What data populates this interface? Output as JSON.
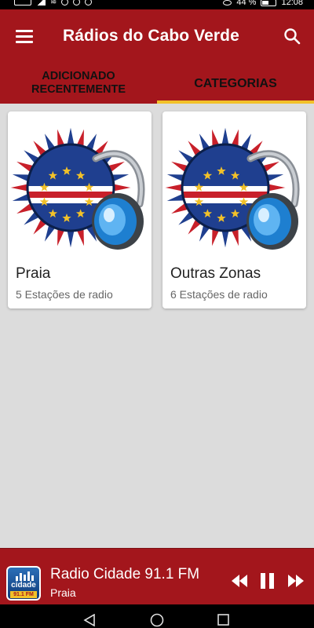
{
  "status_bar": {
    "battery": "44 %",
    "time": "12:08"
  },
  "app_bar": {
    "title": "Rádios do Cabo Verde",
    "menu_icon": "hamburger-menu-icon",
    "search_icon": "search-icon"
  },
  "tabs": [
    {
      "label": "ADICIONADO RECENTEMENTE",
      "active": false
    },
    {
      "label": "CATEGORIAS",
      "active": true
    }
  ],
  "categories": [
    {
      "name": "Praia",
      "count": "5 Estações de radio",
      "image": "cabo-verde-flag-headphones"
    },
    {
      "name": "Outras Zonas",
      "count": "6 Estações de radio",
      "image": "cabo-verde-flag-headphones"
    }
  ],
  "player": {
    "station": "Radio Cidade 91.1 FM",
    "city": "Praia",
    "logo_text": "cidade",
    "logo_freq": "91.1 FM",
    "controls": [
      "rewind-icon",
      "pause-icon",
      "fast-forward-icon"
    ]
  },
  "nav_bar": [
    "back-icon",
    "home-icon",
    "recents-icon"
  ],
  "colors": {
    "primary": "#a3161c",
    "tab_indicator": "#f2c129",
    "background": "#dcdcdc",
    "flag_blue": "#1f3f8f",
    "flag_red": "#c8202a",
    "flag_star": "#f2c129"
  }
}
